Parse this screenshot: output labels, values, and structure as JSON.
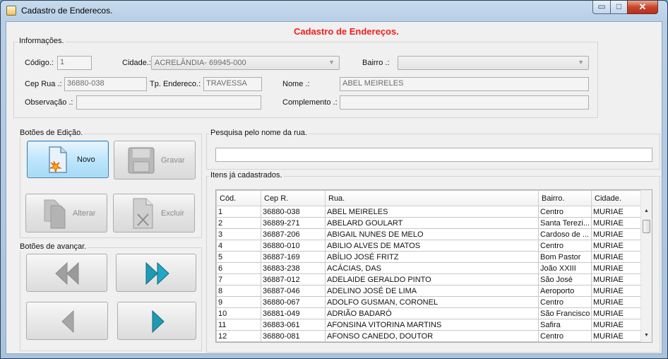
{
  "window": {
    "title": "Cadastro de Enderecos.",
    "min_glyph": "▭",
    "max_glyph": "□",
    "close_glyph": "✕"
  },
  "heading": "Cadastro de Endereços.",
  "info": {
    "group_title": "Informações.",
    "codigo": {
      "label": "Código.:",
      "value": "1"
    },
    "cidade": {
      "label": "Cidade.:",
      "value": "ACRELÂNDIA- 69945-000"
    },
    "bairro": {
      "label": "Bairro .:",
      "value": ""
    },
    "cep": {
      "label": "Cep Rua .:",
      "value": "36880-038"
    },
    "tp_endereco": {
      "label": "Tp. Endereco.:",
      "value": "TRAVESSA"
    },
    "nome": {
      "label": "Nome .:",
      "value": "ABEL MEIRELES"
    },
    "observacao": {
      "label": "Observação .:",
      "value": ""
    },
    "complemento": {
      "label": "Complemento .:",
      "value": ""
    }
  },
  "edit": {
    "group_title": "Botões de Edição.",
    "novo": "Novo",
    "gravar": "Gravar",
    "alterar": "Alterar",
    "excluir": "Excluir"
  },
  "nav": {
    "group_title": "Botões de avançar."
  },
  "search": {
    "group_title": "Pesquisa pelo nome da rua.",
    "value": ""
  },
  "items": {
    "group_title": "Itens já cadastrados.",
    "columns": [
      "Cód.",
      "Cep R.",
      "Rua.",
      "Bairro.",
      "Cidade."
    ],
    "rows": [
      [
        "1",
        "36880-038",
        "ABEL MEIRELES",
        "Centro",
        "MURIAE"
      ],
      [
        "2",
        "36889-271",
        "ABELARD GOULART",
        "Santa Terezi...",
        "MURIAE"
      ],
      [
        "3",
        "36887-206",
        "ABIGAIL NUNES DE MELO",
        "Cardoso de ...",
        "MURIAE"
      ],
      [
        "4",
        "36880-010",
        "ABILIO ALVES DE MATOS",
        "Centro",
        "MURIAE"
      ],
      [
        "5",
        "36887-169",
        "ABÍLIO JOSÉ FRITZ",
        "Bom Pastor",
        "MURIAE"
      ],
      [
        "6",
        "36883-238",
        "ACÁCIAS, DAS",
        "João XXIII",
        "MURIAE"
      ],
      [
        "7",
        "36887-012",
        "ADELAIDE GERALDO PINTO",
        "São José",
        "MURIAE"
      ],
      [
        "8",
        "36887-046",
        "ADELINO JOSÉ DE LIMA",
        "Aeroporto",
        "MURIAE"
      ],
      [
        "9",
        "36880-067",
        "ADOLFO GUSMAN, CORONEL",
        "Centro",
        "MURIAE"
      ],
      [
        "10",
        "36881-049",
        "ADRIÃO BADARÓ",
        "São Francisco",
        "MURIAE"
      ],
      [
        "11",
        "36883-061",
        "AFONSINA VITORINA MARTINS",
        "Safira",
        "MURIAE"
      ],
      [
        "12",
        "36880-081",
        "AFONSO CANEDO, DOUTOR",
        "Centro",
        "MURIAE"
      ]
    ],
    "scroll_up": "▲",
    "scroll_down": "▼"
  }
}
